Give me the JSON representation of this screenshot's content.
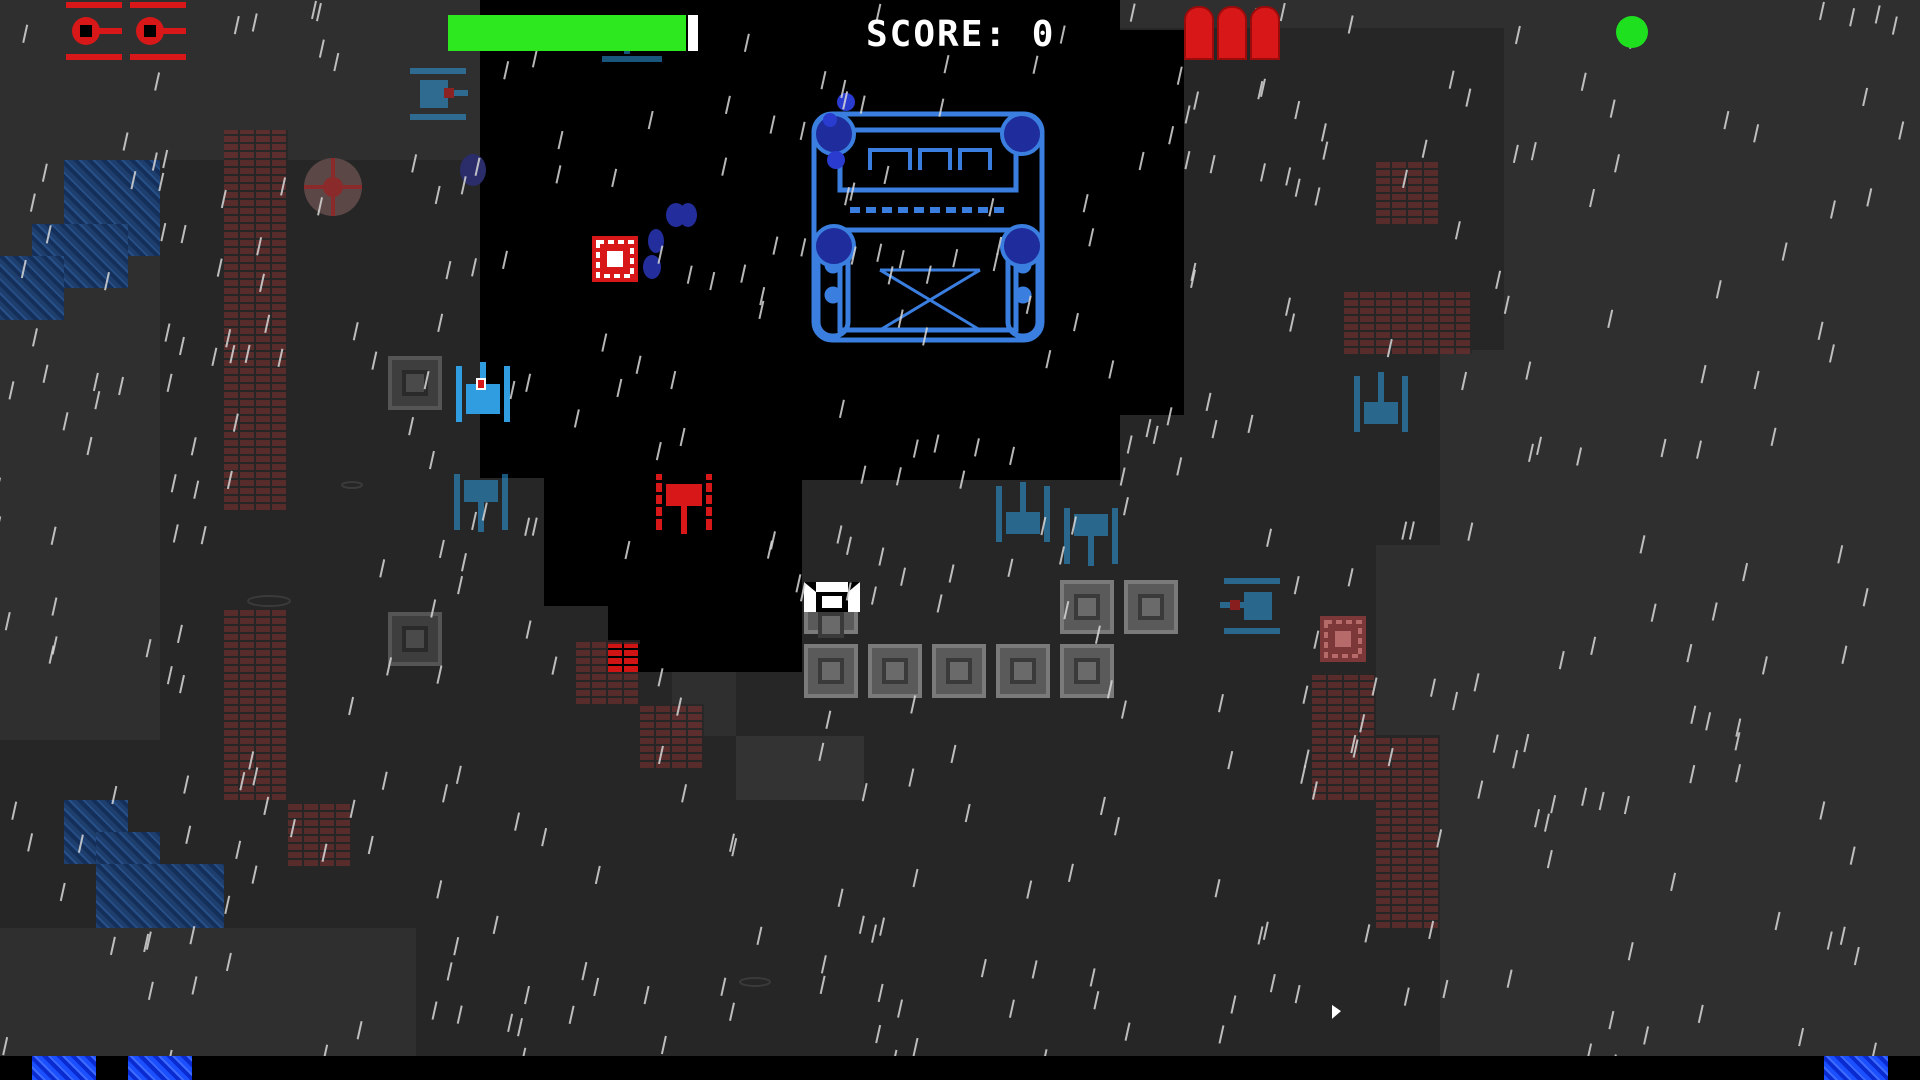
{
  "hud": {
    "score_label": "SCORE:",
    "score_value": "0",
    "lives": 2,
    "health_fraction": 0.95,
    "ammo_shells": 3,
    "status_indicator_color": "#1fe01f"
  },
  "colors": {
    "health_bar": "#2ee81f",
    "player_team": "#d81818",
    "enemy_team": "#2f9de0",
    "boss": "#3a7fe0",
    "brick": "#6b2e2e",
    "water": "#1e3f6e"
  },
  "entities": {
    "player_tank": "red-tank",
    "enemy_tanks": [
      "blue-tank",
      "blue-tank",
      "blue-tank",
      "blue-tank",
      "blue-tank",
      "blue-tank",
      "blue-tank",
      "blue-tank"
    ],
    "boss": "blue-fortress-boss",
    "pickups": [
      "red-crate-pickup",
      "red-crate-pickup",
      "crosshair-target"
    ],
    "weather": "rain"
  }
}
